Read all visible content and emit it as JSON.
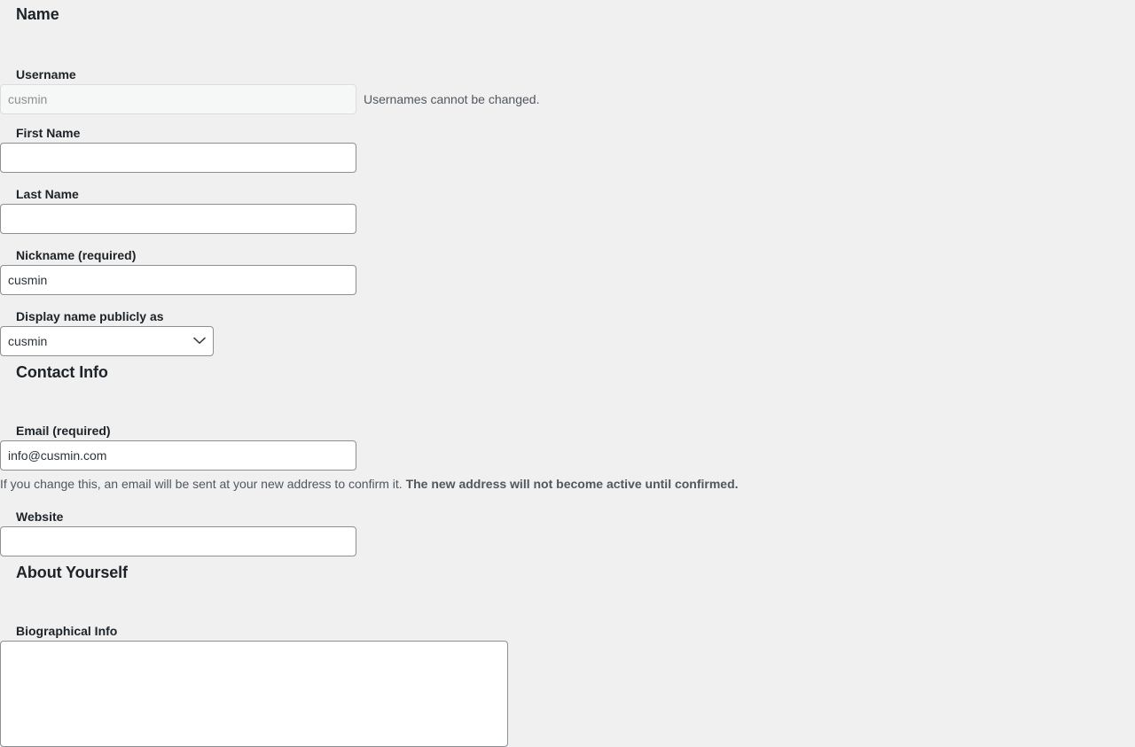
{
  "sections": {
    "name": {
      "heading": "Name"
    },
    "contact": {
      "heading": "Contact Info"
    },
    "about": {
      "heading": "About Yourself"
    }
  },
  "fields": {
    "username": {
      "label": "Username",
      "value": "cusmin",
      "placeholder": "",
      "help": "Usernames cannot be changed.",
      "disabled": true
    },
    "first_name": {
      "label": "First Name",
      "value": "",
      "placeholder": ""
    },
    "last_name": {
      "label": "Last Name",
      "value": "",
      "placeholder": ""
    },
    "nickname": {
      "label": "Nickname (required)",
      "value": "cusmin",
      "placeholder": ""
    },
    "display_name": {
      "label": "Display name publicly as",
      "value": "cusmin",
      "options": [
        "cusmin"
      ],
      "icon": "chevron-down-icon"
    },
    "email": {
      "label": "Email (required)",
      "value": "info@cusmin.com",
      "placeholder": "",
      "description_normal": "If you change this, an email will be sent at your new address to confirm it. ",
      "description_bold": "The new address will not become active until confirmed."
    },
    "website": {
      "label": "Website",
      "value": "",
      "placeholder": ""
    },
    "biographical_info": {
      "label": "Biographical Info",
      "value": "",
      "placeholder": ""
    }
  },
  "colors": {
    "page_background": "#f0f0f1",
    "label_text": "#1d2327",
    "input_text": "#2c3338",
    "help_text": "#50575e",
    "input_border": "#8c8f94",
    "disabled_background": "#f6f7f7",
    "disabled_border": "#dcdcde",
    "disabled_text": "#8c8f94",
    "input_background": "#ffffff"
  }
}
